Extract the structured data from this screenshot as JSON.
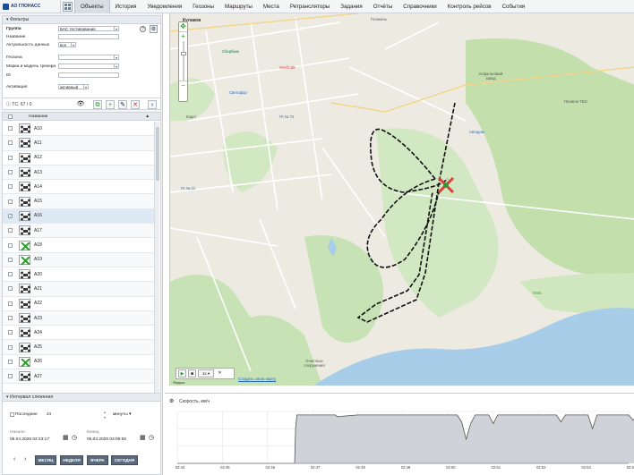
{
  "app": {
    "logo_text": "АО ГЛОНАСС"
  },
  "menu": [
    "Объекты",
    "История",
    "Уведомления",
    "Геозоны",
    "Маршруты",
    "Места",
    "Ретрансляторы",
    "Задания",
    "Отчёты",
    "Справочники",
    "Контроль рейсов",
    "События"
  ],
  "menu_active": 0,
  "filters": {
    "title": "Фильтры",
    "group_label": "Группа",
    "group_value": "БАС тестирование",
    "name_label": "Название",
    "actuality_label": "Актуальность данных",
    "actuality_value": "все",
    "geozone_label": "Геозона",
    "tracker_label": "Марка и модель трекера",
    "id_label": "ID",
    "activation_label": "Активация",
    "activation_value": "активный"
  },
  "toolbar": {
    "count": "ТС: 67 / 0"
  },
  "table": {
    "header_name": "Название",
    "rows": [
      {
        "name": "A10",
        "type": "dark",
        "checked": false
      },
      {
        "name": "A11",
        "type": "dark",
        "checked": false
      },
      {
        "name": "A12",
        "type": "dark",
        "checked": false
      },
      {
        "name": "A13",
        "type": "dark",
        "checked": false
      },
      {
        "name": "A14",
        "type": "dark",
        "checked": false
      },
      {
        "name": "A15",
        "type": "dark",
        "checked": false
      },
      {
        "name": "A16",
        "type": "dark",
        "checked": true
      },
      {
        "name": "A17",
        "type": "dark",
        "checked": false
      },
      {
        "name": "A18",
        "type": "green",
        "checked": false
      },
      {
        "name": "A19",
        "type": "green",
        "checked": false
      },
      {
        "name": "A20",
        "type": "dark",
        "checked": false
      },
      {
        "name": "A21",
        "type": "dark",
        "checked": false
      },
      {
        "name": "A22",
        "type": "dark",
        "checked": false
      },
      {
        "name": "A23",
        "type": "dark",
        "checked": false
      },
      {
        "name": "A24",
        "type": "dark",
        "checked": false
      },
      {
        "name": "A25",
        "type": "dark",
        "checked": false
      },
      {
        "name": "A26",
        "type": "green",
        "checked": false
      },
      {
        "name": "A27",
        "type": "dark",
        "checked": false
      }
    ]
  },
  "interval": {
    "title": "Интервал слежения",
    "last_label": "Последние",
    "last_value": "24",
    "unit": "минуты",
    "start_label": "Начало",
    "start_value": "05.04.2025 02:43:17",
    "end_label": "Конец",
    "end_value": "05.04.2025 03:06:55",
    "buttons": [
      "МЕСЯЦ",
      "НЕДЕЛЯ",
      "ВЧЕРА",
      "СЕГОДНЯ"
    ]
  },
  "map": {
    "labels": [
      "Кулаков",
      "Голоконь",
      "Сбербанк",
      "Хлебтойг",
      "Светофор",
      "ГК № 72",
      "Автодом",
      "Асфальтовый завод",
      "Полигон ТБО",
      "Очистные сооружения",
      "Плёс",
      "ГК № 21",
      "Кадет"
    ],
    "player_speed": "1x",
    "create_map_link": "Создать свою карту",
    "copyright": "Яндекс"
  },
  "chart_data": {
    "type": "area",
    "title": "Скорость, км/ч",
    "x": [
      "02:44",
      "02:45",
      "02:46",
      "02:47",
      "02:48",
      "02:49",
      "02:50",
      "02:51",
      "02:52",
      "02:53",
      "02:54"
    ],
    "x_ticks": [
      "02:44",
      "02:45",
      "02:46",
      "02:47",
      "02:48",
      "02:49",
      "02:50",
      "02:51",
      "02:52",
      "02:53",
      "02:54"
    ],
    "series": [
      {
        "points": [
          [
            0,
            0
          ],
          [
            2.6,
            0
          ],
          [
            2.62,
            20
          ],
          [
            2.65,
            28
          ],
          [
            3.5,
            28
          ],
          [
            3.55,
            27
          ],
          [
            4.0,
            28
          ],
          [
            6.2,
            28
          ],
          [
            6.3,
            24
          ],
          [
            6.4,
            14
          ],
          [
            6.5,
            23
          ],
          [
            6.6,
            28
          ],
          [
            6.9,
            28
          ],
          [
            7.0,
            23
          ],
          [
            7.1,
            28
          ],
          [
            8.4,
            28
          ],
          [
            8.5,
            24
          ],
          [
            8.6,
            28
          ],
          [
            9.1,
            28
          ],
          [
            9.2,
            20
          ],
          [
            9.3,
            28
          ],
          [
            10.0,
            28
          ],
          [
            10.1,
            25
          ],
          [
            10.2,
            28
          ],
          [
            10.5,
            28
          ]
        ]
      }
    ],
    "ylim": [
      0,
      30
    ],
    "grid": true
  },
  "colors": {
    "accent": "#2a6ab7",
    "track": "#111111",
    "drone_green": "#2e9b2e",
    "drone_marker": "#e23b3b"
  }
}
